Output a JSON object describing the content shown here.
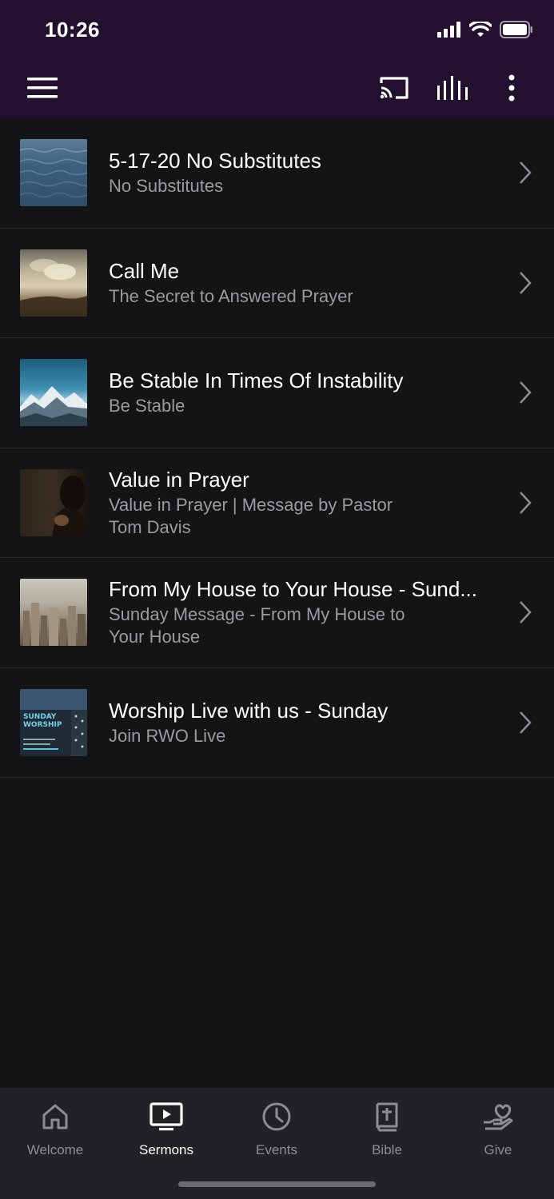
{
  "status": {
    "time": "10:26"
  },
  "sermons": [
    {
      "title": "5-17-20 No Substitutes",
      "subtitle": "No Substitutes",
      "thumb": "ocean-water"
    },
    {
      "title": "Call Me",
      "subtitle": "The Secret to Answered Prayer",
      "thumb": "sky-clouds"
    },
    {
      "title": "Be Stable In Times Of Instability",
      "subtitle": "Be Stable",
      "thumb": "snowy-mountains"
    },
    {
      "title": "Value in Prayer",
      "subtitle": "Value in Prayer | Message by Pastor Tom Davis",
      "thumb": "praying-man"
    },
    {
      "title": "From My House to Your House - Sund...",
      "subtitle": "Sunday Message - From My House to Your House",
      "thumb": "city-skyline"
    },
    {
      "title": "Worship Live with us - Sunday",
      "subtitle": "Join RWO Live",
      "thumb": "sunday-worship-flyer",
      "thumb_text": "SUNDAY WORSHIP"
    }
  ],
  "tabs": [
    {
      "label": "Welcome",
      "icon": "home-icon",
      "active": false
    },
    {
      "label": "Sermons",
      "icon": "tv-play-icon",
      "active": true
    },
    {
      "label": "Events",
      "icon": "clock-icon",
      "active": false
    },
    {
      "label": "Bible",
      "icon": "bible-icon",
      "active": false
    },
    {
      "label": "Give",
      "icon": "give-heart-icon",
      "active": false
    }
  ],
  "colors": {
    "appbar": "#23102f",
    "background": "#141416",
    "tabbar": "#222226",
    "accent_text": "#ffffff",
    "muted_text": "#9a9aa0"
  }
}
